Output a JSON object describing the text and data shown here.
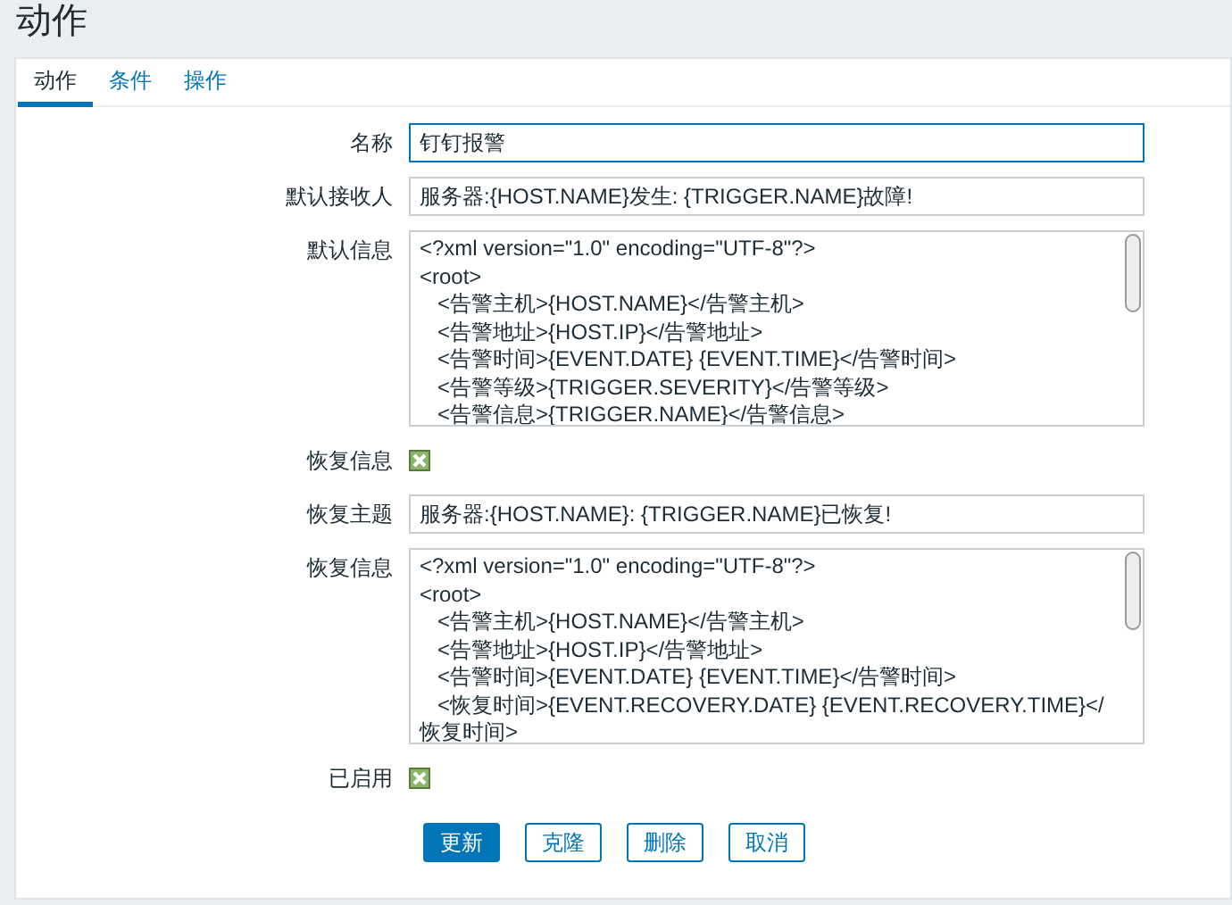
{
  "page": {
    "title": "动作"
  },
  "tabs": [
    {
      "label": "动作",
      "selected": true
    },
    {
      "label": "条件",
      "selected": false
    },
    {
      "label": "操作",
      "selected": false
    }
  ],
  "form": [
    {
      "kind": "input",
      "label": "名称",
      "value": "钉钉报警",
      "focused": true
    },
    {
      "kind": "input",
      "label": "默认接收人",
      "value": "服务器:{HOST.NAME}发生: {TRIGGER.NAME}故障!",
      "focused": false
    },
    {
      "kind": "textarea",
      "label": "默认信息",
      "lines": [
        "<?xml version=\"1.0\" encoding=\"UTF-8\"?>",
        "<root>",
        "   <告警主机>{HOST.NAME}</告警主机>",
        "   <告警地址>{HOST.IP}</告警地址>",
        "   <告警时间>{EVENT.DATE} {EVENT.TIME}</告警时间>",
        "   <告警等级>{TRIGGER.SEVERITY}</告警等级>",
        "   <告警信息>{TRIGGER.NAME}</告警信息>"
      ]
    },
    {
      "kind": "checkbox",
      "label": "恢复信息",
      "checked": true
    },
    {
      "kind": "input",
      "label": "恢复主题",
      "value": "服务器:{HOST.NAME}: {TRIGGER.NAME}已恢复!",
      "focused": false
    },
    {
      "kind": "textarea",
      "label": "恢复信息",
      "lines": [
        "<?xml version=\"1.0\" encoding=\"UTF-8\"?>",
        "<root>",
        "   <告警主机>{HOST.NAME}</告警主机>",
        "   <告警地址>{HOST.IP}</告警地址>",
        "   <告警时间>{EVENT.DATE} {EVENT.TIME}</告警时间>",
        "   <恢复时间>{EVENT.RECOVERY.DATE} {EVENT.RECOVERY.TIME}</恢复时间>"
      ]
    },
    {
      "kind": "checkbox",
      "label": "已启用",
      "checked": true
    }
  ],
  "buttons": [
    {
      "label": "更新",
      "primary": true
    },
    {
      "label": "克隆",
      "primary": false
    },
    {
      "label": "删除",
      "primary": false
    },
    {
      "label": "取消",
      "primary": false
    }
  ]
}
